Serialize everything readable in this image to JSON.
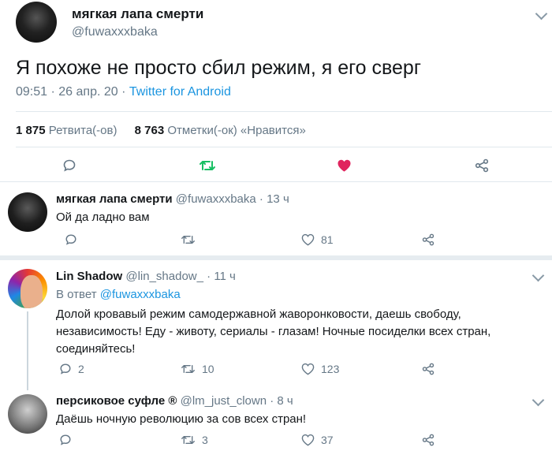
{
  "main": {
    "name": "мягкая лапа смерти",
    "handle": "@fuwaxxxbaka",
    "text": "Я похоже не просто сбил режим, я его сверг",
    "time": "09:51",
    "date": "26 апр. 20",
    "source": "Twitter for Android",
    "retweets_count": "1 875",
    "retweets_label": "Ретвита(-ов)",
    "likes_count": "8 763",
    "likes_label": "Отметки(-ок) «Нравится»",
    "colors": {
      "retweet": "#17bf63",
      "like": "#e0245e"
    }
  },
  "replies": [
    {
      "name": "мягкая лапа смерти",
      "handle": "@fuwaxxxbaka",
      "age": "13 ч",
      "text": "Ой да ладно вам",
      "replies": "",
      "retweets": "",
      "likes": "81"
    },
    {
      "name": "Lin Shadow",
      "handle": "@lin_shadow_",
      "age": "11 ч",
      "reply_to_label": "В ответ",
      "reply_to": "@fuwaxxxbaka",
      "text": "Долой кровавый режим самодержавной жаворонковости, даешь свободу, независимость! Еду - животу, сериалы - глазам! Ночные посиделки всех стран, соединяйтесь!",
      "replies": "2",
      "retweets": "10",
      "likes": "123"
    },
    {
      "name": "персиковое суфле ®",
      "handle": "@lm_just_clown",
      "age": "8 ч",
      "text": "Даёшь ночную революцию за сов всех стран!",
      "replies": "",
      "retweets": "3",
      "likes": "37"
    }
  ]
}
